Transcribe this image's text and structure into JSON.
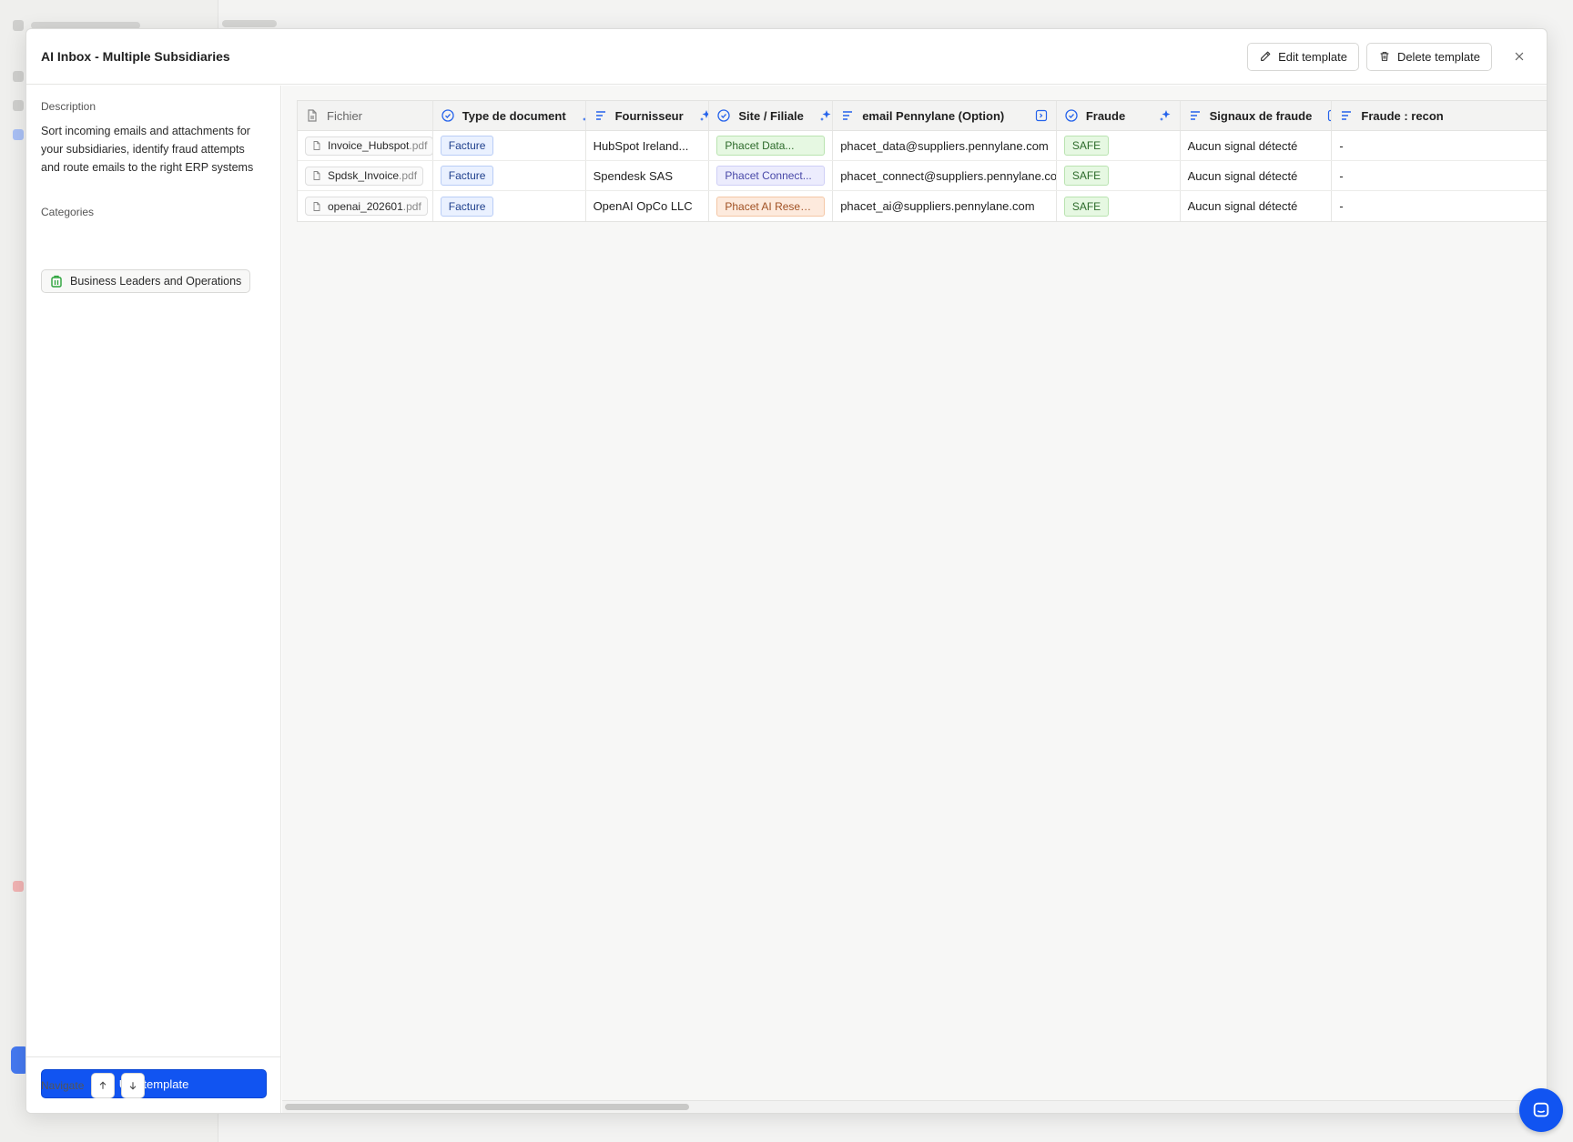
{
  "modal": {
    "title": "AI Inbox - Multiple Subsidiaries",
    "edit_label": "Edit template",
    "delete_label": "Delete template"
  },
  "sidebar": {
    "description_label": "Description",
    "description": "Sort incoming emails and attachments for your subsidiaries, identify fraud attempts and route emails to the right ERP systems",
    "categories_label": "Categories",
    "category": "Business Leaders and Operations",
    "use_template_label": "Use template",
    "navigate_label": "Navigate"
  },
  "table": {
    "columns": [
      {
        "label": "Fichier",
        "icon": "file-icon"
      },
      {
        "label": "Type de document",
        "icon": "check-circle-icon"
      },
      {
        "label": "Fournisseur",
        "icon": "text-lines-icon"
      },
      {
        "label": "Site / Filiale",
        "icon": "check-circle-icon"
      },
      {
        "label": "email Pennylane (Option)",
        "icon": "text-lines-icon"
      },
      {
        "label": "Fraude",
        "icon": "check-circle-icon"
      },
      {
        "label": "Signaux de fraude",
        "icon": "text-lines-icon"
      },
      {
        "label": "Fraude : recon",
        "icon": "text-lines-icon"
      }
    ],
    "rows": [
      {
        "file_name": "Invoice_Hubspot",
        "file_ext": ".pdf",
        "type": "Facture",
        "supplier": "HubSpot Ireland...",
        "site": "Phacet Data...",
        "email": "phacet_data@suppliers.pennylane.com",
        "fraud": "SAFE",
        "signals": "Aucun signal détecté",
        "recon": "-"
      },
      {
        "file_name": "Spdsk_Invoice",
        "file_ext": ".pdf",
        "type": "Facture",
        "supplier": "Spendesk SAS",
        "site": "Phacet Connect...",
        "email": "phacet_connect@suppliers.pennylane.com",
        "fraud": "SAFE",
        "signals": "Aucun signal détecté",
        "recon": "-"
      },
      {
        "file_name": "openai_202601",
        "file_ext": ".pdf",
        "type": "Facture",
        "supplier": "OpenAI OpCo LLC",
        "site": "Phacet AI Research...",
        "email": "phacet_ai@suppliers.pennylane.com",
        "fraud": "SAFE",
        "signals": "Aucun signal détecté",
        "recon": "-"
      }
    ]
  },
  "colors": {
    "primary": "#1154f1",
    "accent_icon": "#2563eb"
  }
}
